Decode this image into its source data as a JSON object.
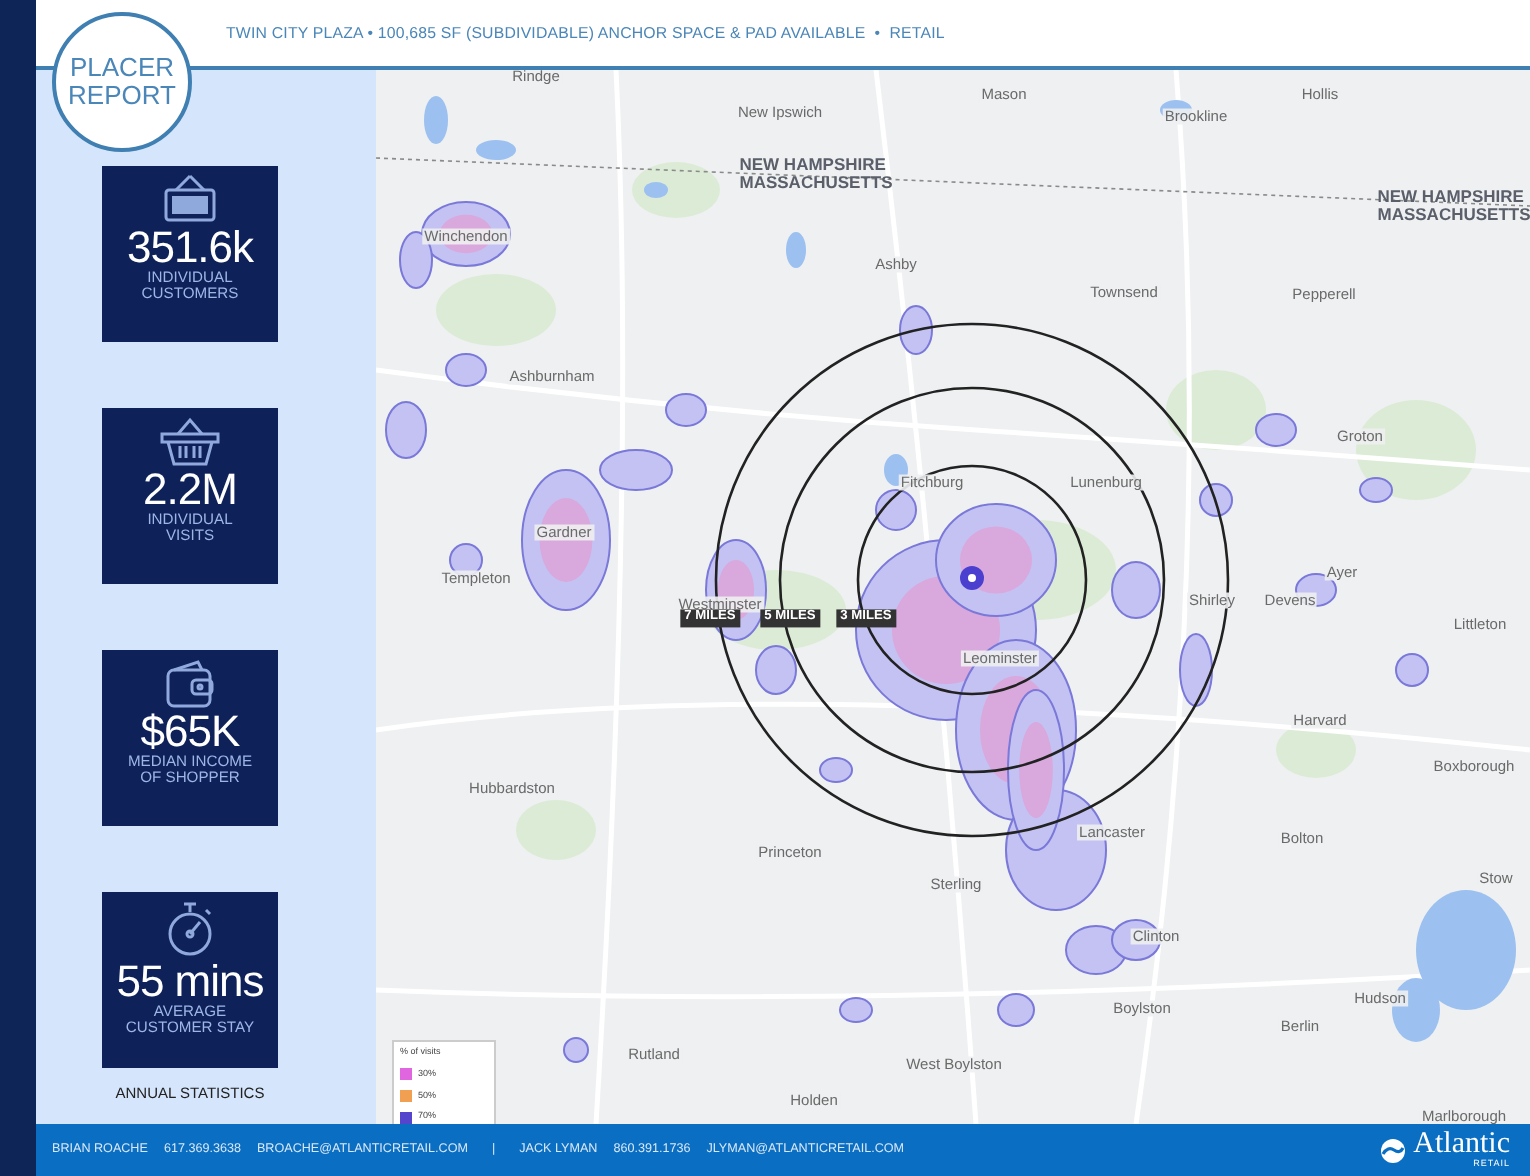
{
  "header": {
    "badge_lines": [
      "PLACER",
      "REPORT"
    ],
    "title": "TWIN CITY PLAZA • 100,685 SF (SUBDIVIDABLE) ANCHOR SPACE & PAD AVAILABLE  •  RETAIL"
  },
  "stats": [
    {
      "kind": "open-sign",
      "value": "351.6k",
      "lines": [
        "INDIVIDUAL",
        "CUSTOMERS"
      ]
    },
    {
      "kind": "basket",
      "value": "2.2M",
      "lines": [
        "INDIVIDUAL",
        "VISITS"
      ]
    },
    {
      "kind": "wallet",
      "value": "$65K",
      "lines": [
        "MEDIAN INCOME",
        "OF SHOPPER"
      ]
    },
    {
      "kind": "stopwatch",
      "value": "55 mins",
      "lines": [
        "AVERAGE",
        "CUSTOMER STAY"
      ]
    }
  ],
  "stats_caption": "ANNUAL STATISTICS",
  "map": {
    "state_labels": [
      {
        "lines": [
          "NEW HAMPSHIRE",
          "MASSACHUSETTS"
        ]
      },
      {
        "lines": [
          "NEW HAMPSHIRE",
          "MASSACHUSETTS"
        ]
      }
    ],
    "towns": [
      "Rindge",
      "New Ipswich",
      "Mason",
      "Brookline",
      "Hollis",
      "Winchendon",
      "Ashby",
      "Townsend",
      "Pepperell",
      "Ashburnham",
      "Lunenburg",
      "Groton",
      "Fitchburg",
      "Gardner",
      "Templeton",
      "Westminster",
      "Leominster",
      "Ayer",
      "Shirley",
      "Devens",
      "Littleton",
      "Harvard",
      "Boxborough",
      "Hubbardston",
      "Princeton",
      "Lancaster",
      "Bolton",
      "Stow",
      "Sterling",
      "Clinton",
      "Boylston",
      "Hudson",
      "Berlin",
      "West Boylston",
      "Rutland",
      "Holden",
      "Marlborough"
    ],
    "rings": [
      {
        "label": "7 MILES"
      },
      {
        "label": "5 MILES"
      },
      {
        "label": "3 MILES"
      }
    ],
    "legend": {
      "title": "% of visits",
      "items": [
        {
          "label": "30%",
          "color": "#e066e0"
        },
        {
          "label": "50%",
          "color": "#f0a050"
        },
        {
          "label": "70%",
          "color": "#5544cc"
        }
      ]
    }
  },
  "footer": {
    "contacts": [
      {
        "name": "BRIAN ROACHE",
        "phone": "617.369.3638",
        "email": "BROACHE@ATLANTICRETAIL.COM"
      },
      {
        "name": "JACK LYMAN",
        "phone": "860.391.1736",
        "email": "JLYMAN@ATLANTICRETAIL.COM"
      }
    ],
    "separator": "|",
    "logo": {
      "name": "Atlantic",
      "sub": "RETAIL"
    }
  }
}
